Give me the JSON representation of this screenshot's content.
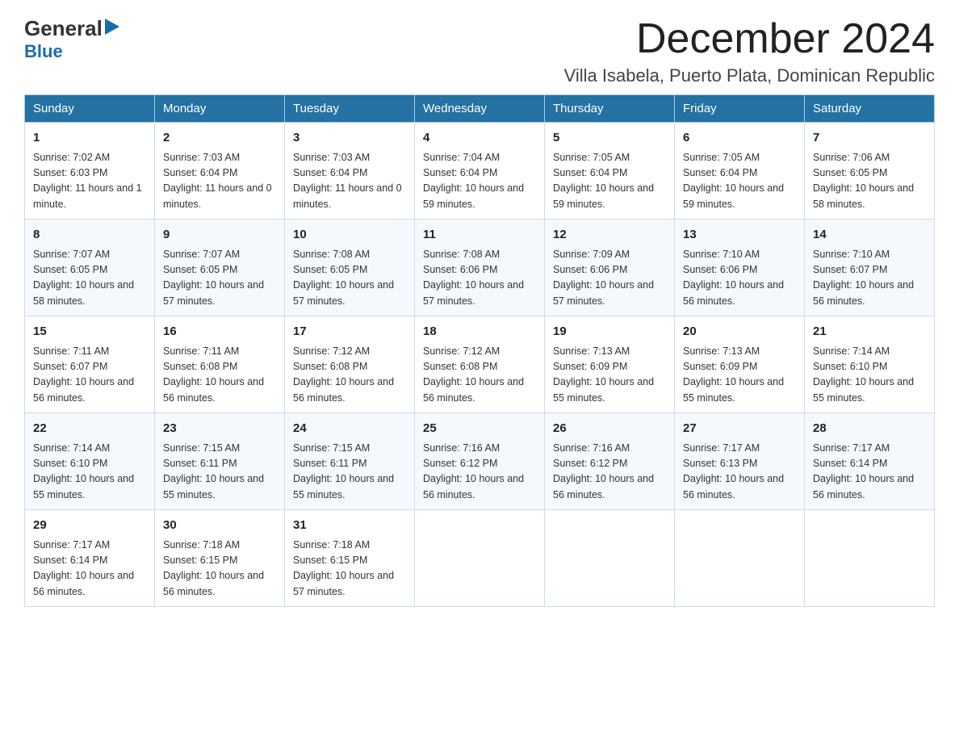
{
  "logo": {
    "line1": "General",
    "triangle": "▶",
    "line2": "Blue"
  },
  "title": {
    "month": "December 2024",
    "location": "Villa Isabela, Puerto Plata, Dominican Republic"
  },
  "days_header": [
    "Sunday",
    "Monday",
    "Tuesday",
    "Wednesday",
    "Thursday",
    "Friday",
    "Saturday"
  ],
  "weeks": [
    [
      {
        "day": "1",
        "sunrise": "7:02 AM",
        "sunset": "6:03 PM",
        "daylight": "11 hours and 1 minute."
      },
      {
        "day": "2",
        "sunrise": "7:03 AM",
        "sunset": "6:04 PM",
        "daylight": "11 hours and 0 minutes."
      },
      {
        "day": "3",
        "sunrise": "7:03 AM",
        "sunset": "6:04 PM",
        "daylight": "11 hours and 0 minutes."
      },
      {
        "day": "4",
        "sunrise": "7:04 AM",
        "sunset": "6:04 PM",
        "daylight": "10 hours and 59 minutes."
      },
      {
        "day": "5",
        "sunrise": "7:05 AM",
        "sunset": "6:04 PM",
        "daylight": "10 hours and 59 minutes."
      },
      {
        "day": "6",
        "sunrise": "7:05 AM",
        "sunset": "6:04 PM",
        "daylight": "10 hours and 59 minutes."
      },
      {
        "day": "7",
        "sunrise": "7:06 AM",
        "sunset": "6:05 PM",
        "daylight": "10 hours and 58 minutes."
      }
    ],
    [
      {
        "day": "8",
        "sunrise": "7:07 AM",
        "sunset": "6:05 PM",
        "daylight": "10 hours and 58 minutes."
      },
      {
        "day": "9",
        "sunrise": "7:07 AM",
        "sunset": "6:05 PM",
        "daylight": "10 hours and 57 minutes."
      },
      {
        "day": "10",
        "sunrise": "7:08 AM",
        "sunset": "6:05 PM",
        "daylight": "10 hours and 57 minutes."
      },
      {
        "day": "11",
        "sunrise": "7:08 AM",
        "sunset": "6:06 PM",
        "daylight": "10 hours and 57 minutes."
      },
      {
        "day": "12",
        "sunrise": "7:09 AM",
        "sunset": "6:06 PM",
        "daylight": "10 hours and 57 minutes."
      },
      {
        "day": "13",
        "sunrise": "7:10 AM",
        "sunset": "6:06 PM",
        "daylight": "10 hours and 56 minutes."
      },
      {
        "day": "14",
        "sunrise": "7:10 AM",
        "sunset": "6:07 PM",
        "daylight": "10 hours and 56 minutes."
      }
    ],
    [
      {
        "day": "15",
        "sunrise": "7:11 AM",
        "sunset": "6:07 PM",
        "daylight": "10 hours and 56 minutes."
      },
      {
        "day": "16",
        "sunrise": "7:11 AM",
        "sunset": "6:08 PM",
        "daylight": "10 hours and 56 minutes."
      },
      {
        "day": "17",
        "sunrise": "7:12 AM",
        "sunset": "6:08 PM",
        "daylight": "10 hours and 56 minutes."
      },
      {
        "day": "18",
        "sunrise": "7:12 AM",
        "sunset": "6:08 PM",
        "daylight": "10 hours and 56 minutes."
      },
      {
        "day": "19",
        "sunrise": "7:13 AM",
        "sunset": "6:09 PM",
        "daylight": "10 hours and 55 minutes."
      },
      {
        "day": "20",
        "sunrise": "7:13 AM",
        "sunset": "6:09 PM",
        "daylight": "10 hours and 55 minutes."
      },
      {
        "day": "21",
        "sunrise": "7:14 AM",
        "sunset": "6:10 PM",
        "daylight": "10 hours and 55 minutes."
      }
    ],
    [
      {
        "day": "22",
        "sunrise": "7:14 AM",
        "sunset": "6:10 PM",
        "daylight": "10 hours and 55 minutes."
      },
      {
        "day": "23",
        "sunrise": "7:15 AM",
        "sunset": "6:11 PM",
        "daylight": "10 hours and 55 minutes."
      },
      {
        "day": "24",
        "sunrise": "7:15 AM",
        "sunset": "6:11 PM",
        "daylight": "10 hours and 55 minutes."
      },
      {
        "day": "25",
        "sunrise": "7:16 AM",
        "sunset": "6:12 PM",
        "daylight": "10 hours and 56 minutes."
      },
      {
        "day": "26",
        "sunrise": "7:16 AM",
        "sunset": "6:12 PM",
        "daylight": "10 hours and 56 minutes."
      },
      {
        "day": "27",
        "sunrise": "7:17 AM",
        "sunset": "6:13 PM",
        "daylight": "10 hours and 56 minutes."
      },
      {
        "day": "28",
        "sunrise": "7:17 AM",
        "sunset": "6:14 PM",
        "daylight": "10 hours and 56 minutes."
      }
    ],
    [
      {
        "day": "29",
        "sunrise": "7:17 AM",
        "sunset": "6:14 PM",
        "daylight": "10 hours and 56 minutes."
      },
      {
        "day": "30",
        "sunrise": "7:18 AM",
        "sunset": "6:15 PM",
        "daylight": "10 hours and 56 minutes."
      },
      {
        "day": "31",
        "sunrise": "7:18 AM",
        "sunset": "6:15 PM",
        "daylight": "10 hours and 57 minutes."
      },
      null,
      null,
      null,
      null
    ]
  ]
}
